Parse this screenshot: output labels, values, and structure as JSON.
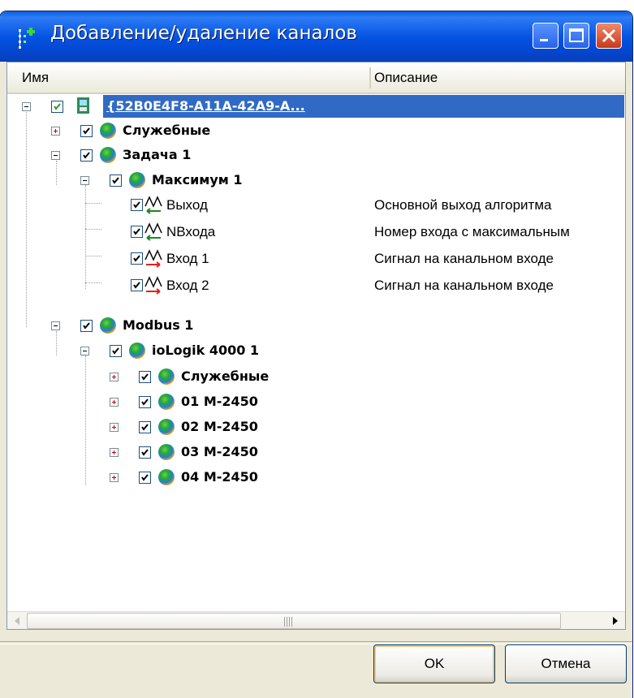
{
  "window": {
    "title": "Добавление/удаление каналов"
  },
  "stray_mark": ",",
  "columns": {
    "name": "Имя",
    "description": "Описание"
  },
  "tree": {
    "root": {
      "label": "{52B0E4F8-A11A-42A9-A...",
      "checked": true,
      "expanded": true
    },
    "sluzhebnye_top": {
      "label": "Служебные",
      "checked": true,
      "expanded": false
    },
    "zadacha": {
      "label": "Задача 1",
      "checked": true,
      "expanded": true
    },
    "maximum": {
      "label": "Максимум 1",
      "checked": true,
      "expanded": true
    },
    "channels": [
      {
        "label": "Выход",
        "description": "Основной выход алгоритма",
        "direction": "out",
        "checked": true
      },
      {
        "label": "NВхода",
        "description": "Номер входа с максимальным",
        "direction": "out",
        "checked": true
      },
      {
        "label": "Вход 1",
        "description": "Сигнал на канальном входе",
        "direction": "in",
        "checked": true
      },
      {
        "label": "Вход 2",
        "description": "Сигнал на канальном входе",
        "direction": "in",
        "checked": true
      }
    ],
    "modbus": {
      "label": "Modbus 1",
      "checked": true,
      "expanded": true
    },
    "iologik": {
      "label": "ioLogik 4000 1",
      "checked": true,
      "expanded": true
    },
    "iologik_children": [
      {
        "label": "Служебные",
        "checked": true,
        "expanded": false
      },
      {
        "label": "01 M-2450",
        "checked": true,
        "expanded": false
      },
      {
        "label": "02 M-2450",
        "checked": true,
        "expanded": false
      },
      {
        "label": "03 M-2450",
        "checked": true,
        "expanded": false
      },
      {
        "label": "04 M-2450",
        "checked": true,
        "expanded": false
      }
    ]
  },
  "buttons": {
    "ok": "OK",
    "cancel": "Отмена"
  },
  "colors": {
    "selection": "#316ac5",
    "titlebar": "#0554e3",
    "close": "#c8391a",
    "arrow_out": "#1a8a1a",
    "arrow_in": "#e02020"
  }
}
